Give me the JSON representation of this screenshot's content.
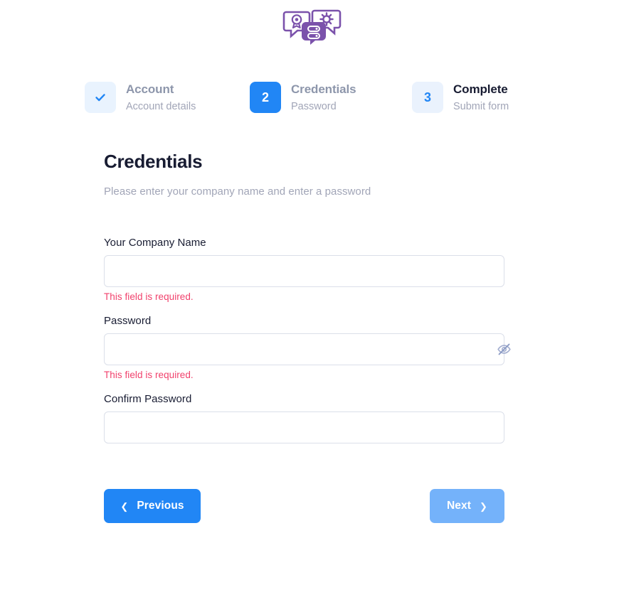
{
  "brand": {
    "logo_icon": "chat-bubbles-server-logo",
    "logo_color": "#7b52ab"
  },
  "colors": {
    "primary": "#2186f5",
    "primary_faded": "#74b2fa",
    "badge_light": "#e9f3fe",
    "error": "#f1416c",
    "muted_text": "#a1a5b7",
    "step_title_muted": "#8d96ab",
    "dark_text": "#181c32",
    "input_border": "#dbdfe9"
  },
  "stepper": {
    "steps": [
      {
        "number": "1",
        "indicator": "check-icon",
        "state": "completed",
        "title": "Account",
        "subtitle": "Account details"
      },
      {
        "number": "2",
        "indicator": "2",
        "state": "active",
        "title": "Credentials",
        "subtitle": "Password"
      },
      {
        "number": "3",
        "indicator": "3",
        "state": "pending",
        "title": "Complete",
        "subtitle": "Submit form"
      }
    ]
  },
  "form": {
    "title": "Credentials",
    "subtitle": "Please enter your company name and enter a password",
    "fields": [
      {
        "label": "Your Company Name",
        "value": "",
        "placeholder": "",
        "error": "This field is required.",
        "type": "text"
      },
      {
        "label": "Password",
        "value": "",
        "placeholder": "",
        "error": "This field is required.",
        "type": "password",
        "toggle_icon": "eye-off-icon"
      },
      {
        "label": "Confirm Password",
        "value": "",
        "placeholder": "",
        "error": "",
        "type": "password"
      }
    ]
  },
  "actions": {
    "previous_label": "Previous",
    "previous_icon": "chevron-left-icon",
    "next_label": "Next",
    "next_icon": "chevron-right-icon",
    "next_state": "disabled"
  }
}
